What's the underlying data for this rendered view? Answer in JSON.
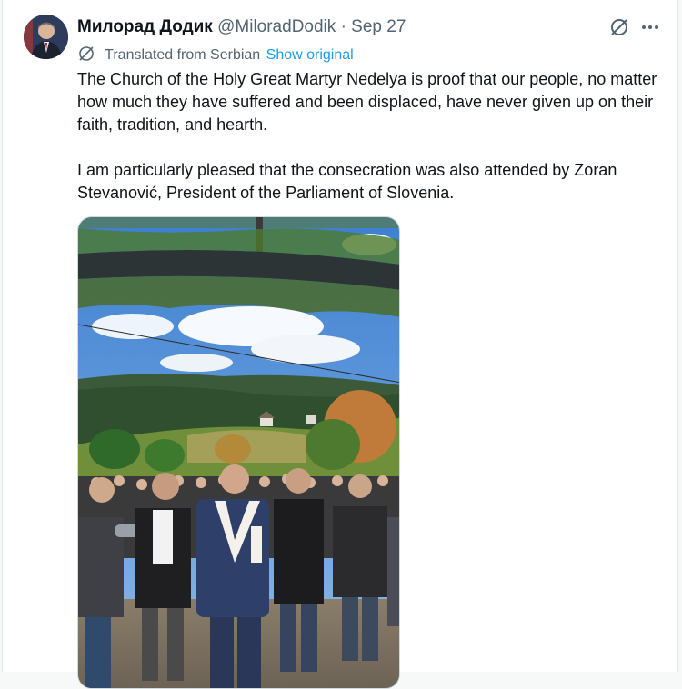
{
  "tweet": {
    "author_name": "Милорад Додик",
    "handle": "@MiloradDodik",
    "separator": "·",
    "date": "Sep 27",
    "translated_label": "Translated from Serbian",
    "show_original": "Show original",
    "paragraphs": [
      "The Church of the Holy Great Martyr Nedelya is proof that our people, no matter how much they have suffered and been displaced, have never given up on their faith, tradition, and hearth.",
      "I am particularly pleased that the consecration was also attended by Zoran Stevanović, President of the Parliament of Slovenia."
    ],
    "more_icon": "more-horizontal-icon",
    "grok_icon": "grok-icon"
  },
  "colors": {
    "text": "#0f1419",
    "secondary": "#536471",
    "link": "#1d9bf0"
  }
}
